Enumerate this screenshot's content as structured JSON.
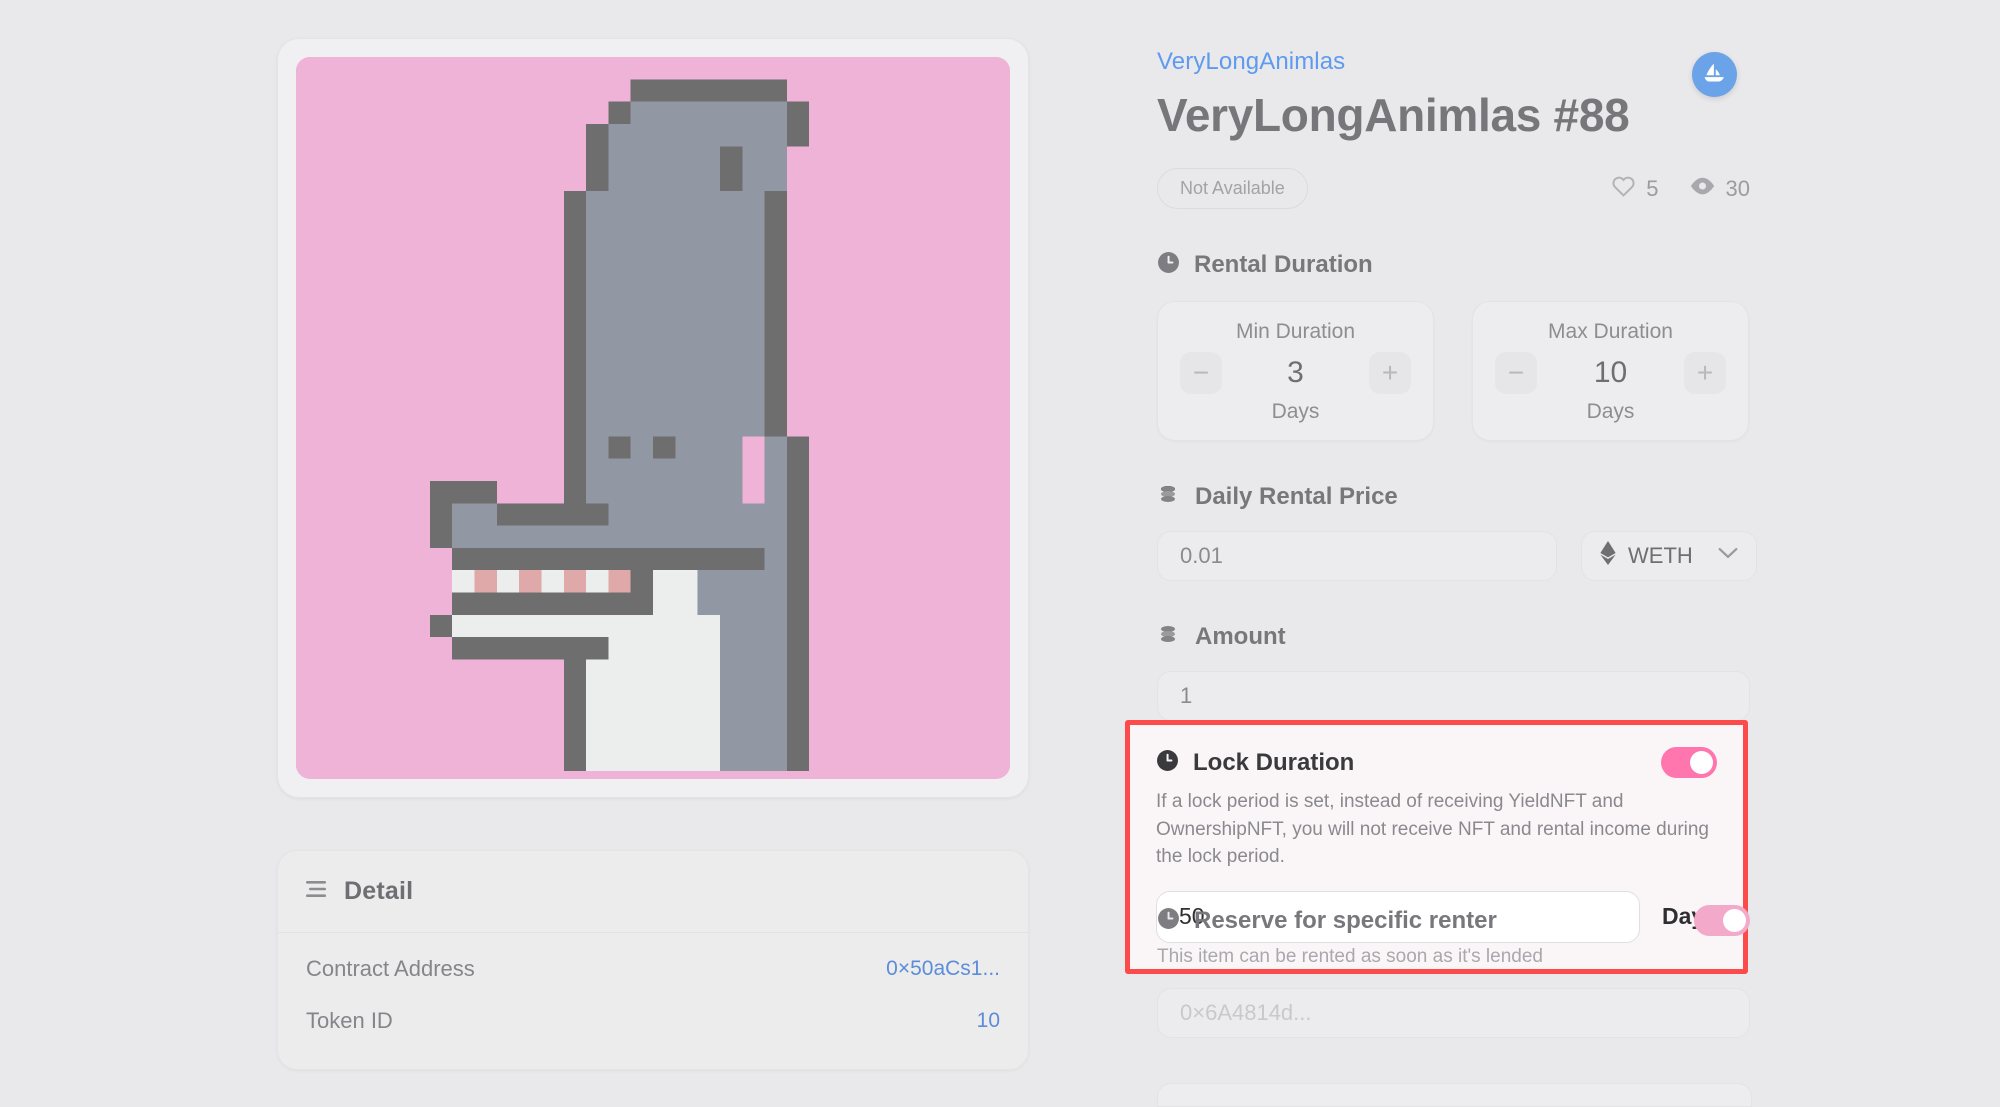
{
  "colors": {
    "page_bg": "#e9e8ea",
    "accent_link": "#5e9bf0",
    "highlight_border": "#fd4a4a",
    "toggle_on": "#ff76ae",
    "toggle_soft": "#f3aaca",
    "nft_bg_pink": "#eeb3d6",
    "nft_gray_light": "#9197a3",
    "nft_gray_dark": "#6e6e6e",
    "nft_white": "#eceded",
    "nft_tooth_pink": "#e0a9a9"
  },
  "header": {
    "collection": "VeryLongAnimlas",
    "title": "VeryLongAnimlas #88",
    "opensea_icon": "sailboat-icon",
    "status_badge": "Not Available",
    "likes": "5",
    "views": "30",
    "like_icon": "heart-icon",
    "view_icon": "eye-icon"
  },
  "rental_duration": {
    "icon": "clock-icon",
    "label": "Rental Duration",
    "min": {
      "caption": "Min Duration",
      "value": "3",
      "unit": "Days",
      "minus": "−",
      "plus": "+"
    },
    "max": {
      "caption": "Max Duration",
      "value": "10",
      "unit": "Days",
      "minus": "−",
      "plus": "+"
    }
  },
  "daily_rental_price": {
    "icon": "coins-icon",
    "label": "Daily Rental Price",
    "value": "0.01",
    "currency": "WETH",
    "currency_icon": "ethereum-icon",
    "chevron": "chevron-down-icon"
  },
  "amount": {
    "icon": "coins-icon",
    "label": "Amount",
    "value": "1"
  },
  "lock_duration": {
    "icon": "clock-icon",
    "label": "Lock Duration",
    "toggle_state": "on",
    "description": "If a lock period is set, instead of receiving YieldNFT and OwnershipNFT, you will not receive NFT and rental income during the lock period.",
    "value": "50",
    "unit": "Days"
  },
  "reserve": {
    "icon": "clock-icon",
    "label": "Reserve for specific renter",
    "toggle_state": "on",
    "description": "This item can be rented as soon as it's lended",
    "address_placeholder": "0×6A4814d..."
  },
  "detail": {
    "icon": "lines-icon",
    "title": "Detail",
    "rows": [
      {
        "key": "Contract Address",
        "value": "0×50aCs1..."
      },
      {
        "key": "Token ID",
        "value": "10"
      }
    ]
  }
}
